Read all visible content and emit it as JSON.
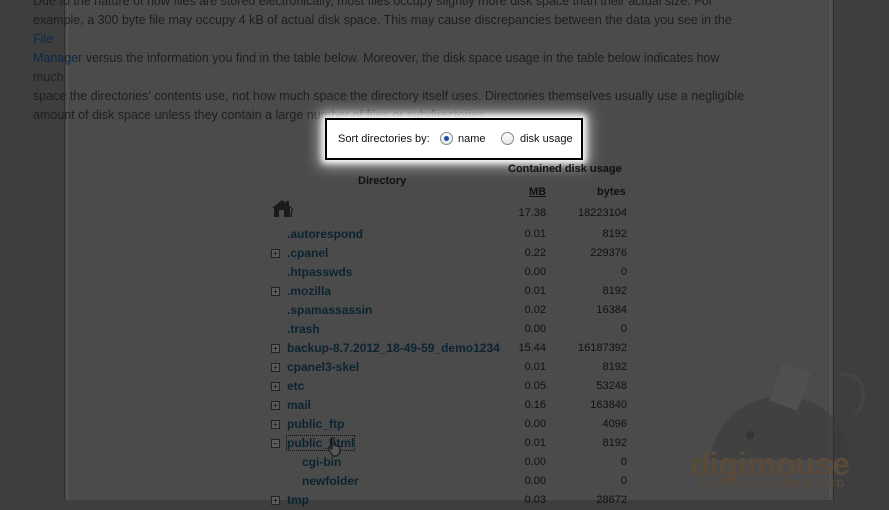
{
  "intro": {
    "line1": "Due to the nature of how files are stored electronically, most files occupy slightly more disk space than their actual size. For",
    "line2_a": "example, a 300 byte file may occupy 4 kB of actual disk space. This may cause discrepancies between the data you see in the ",
    "line2_link": "File",
    "line3_link": "Manager",
    "line3_b": " versus the information you find in the table below. Moreover, the disk space usage in the table below indicates how much",
    "line4": "space the directories' contents use, not how much space the directory itself uses. Directories themselves usually use a negligible",
    "line5": "amount of disk space unless they contain a large number of files or subdirectories."
  },
  "sort": {
    "label": "Sort directories by:",
    "option_name": "name",
    "option_usage": "disk usage",
    "selected": "name"
  },
  "table": {
    "col_directory": "Directory",
    "col_contained": "Contained disk usage",
    "col_mb": "MB",
    "col_bytes": "bytes",
    "root": {
      "name": "/",
      "mb": "17.38",
      "bytes": "18223104"
    },
    "rows": [
      {
        "name": ".autorespond",
        "mb": "0.01",
        "bytes": "8192",
        "expander": ""
      },
      {
        "name": ".cpanel",
        "mb": "0.22",
        "bytes": "229376",
        "expander": "+"
      },
      {
        "name": ".htpasswds",
        "mb": "0.00",
        "bytes": "0",
        "expander": ""
      },
      {
        "name": ".mozilla",
        "mb": "0.01",
        "bytes": "8192",
        "expander": "+"
      },
      {
        "name": ".spamassassin",
        "mb": "0.02",
        "bytes": "16384",
        "expander": ""
      },
      {
        "name": ".trash",
        "mb": "0.00",
        "bytes": "0",
        "expander": ""
      },
      {
        "name": "backup-8.7.2012_18-49-59_demo1234",
        "mb": "15.44",
        "bytes": "16187392",
        "expander": "+"
      },
      {
        "name": "cpanel3-skel",
        "mb": "0.01",
        "bytes": "8192",
        "expander": "+"
      },
      {
        "name": "etc",
        "mb": "0.05",
        "bytes": "53248",
        "expander": "+"
      },
      {
        "name": "mail",
        "mb": "0.16",
        "bytes": "163840",
        "expander": "+"
      },
      {
        "name": "public_ftp",
        "mb": "0.00",
        "bytes": "4096",
        "expander": "+"
      },
      {
        "name": "public_html",
        "mb": "0.01",
        "bytes": "8192",
        "expander": "−"
      },
      {
        "name": "cgi-bin",
        "mb": "0.00",
        "bytes": "0",
        "expander": "",
        "sub": true
      },
      {
        "name": "newfolder",
        "mb": "0.00",
        "bytes": "0",
        "expander": "",
        "sub": true
      },
      {
        "name": "tmp",
        "mb": "0.03",
        "bytes": "28672",
        "expander": "+"
      }
    ]
  },
  "watermark": {
    "brand": "digimouse",
    "tagline": "DIGITAL MARKETING"
  },
  "icons": {
    "home": "home-icon",
    "cursor": "pointer-cursor-icon"
  }
}
